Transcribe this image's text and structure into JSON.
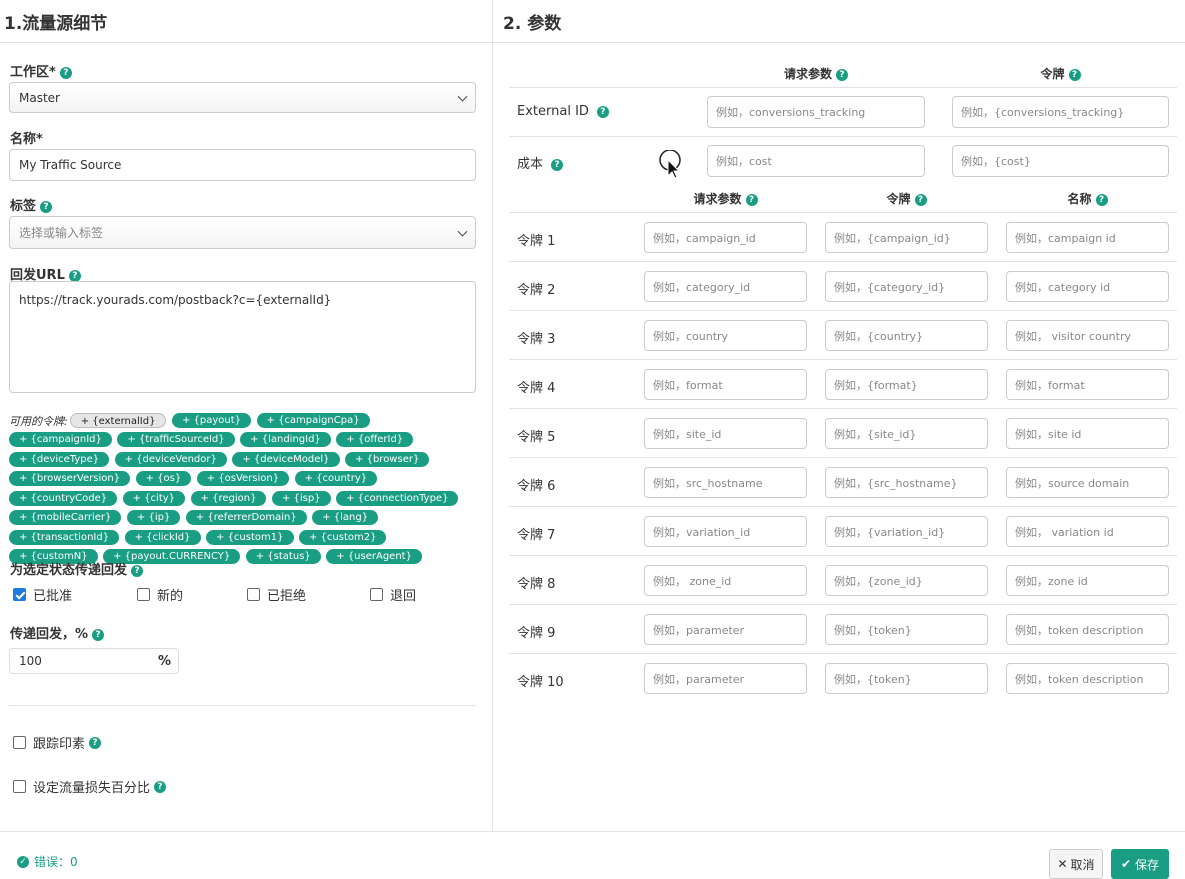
{
  "left": {
    "title": "1.流量源细节",
    "workspace": {
      "label": "工作区*",
      "value": "Master"
    },
    "name": {
      "label": "名称*",
      "value": "My Traffic Source"
    },
    "tags": {
      "label": "标签",
      "placeholder": "选择或输入标签"
    },
    "postback": {
      "label": "回发URL",
      "value": "https://track.yourads.com/postback?c={externalId}"
    },
    "tokens_label": "可用的令牌:",
    "tokens": [
      "+ {externalId}",
      "+ {payout}",
      "+ {campaignCpa}",
      "+ {campaignId}",
      "+ {trafficSourceId}",
      "+ {landingId}",
      "+ {offerId}",
      "+ {deviceType}",
      "+ {deviceVendor}",
      "+ {deviceModel}",
      "+ {browser}",
      "+ {browserVersion}",
      "+ {os}",
      "+ {osVersion}",
      "+ {country}",
      "+ {countryCode}",
      "+ {city}",
      "+ {region}",
      "+ {isp}",
      "+ {connectionType}",
      "+ {mobileCarrier}",
      "+ {ip}",
      "+ {referrerDomain}",
      "+ {lang}",
      "+ {transactionId}",
      "+ {clickId}",
      "+ {custom1}",
      "+ {custom2}",
      "+ {customN}",
      "+ {payout.CURRENCY}",
      "+ {status}",
      "+ {userAgent}"
    ],
    "status_label": "为选定状态传递回发",
    "status_options": [
      {
        "label": "已批准",
        "checked": true
      },
      {
        "label": "新的",
        "checked": false
      },
      {
        "label": "已拒绝",
        "checked": false
      },
      {
        "label": "退回",
        "checked": false
      }
    ],
    "percent_label": "传递回发，%",
    "percent_value": "100",
    "percent_sign": "%",
    "pixel_label": "跟踪印素",
    "loss_label": "设定流量损失百分比"
  },
  "right": {
    "title": "2. 参数",
    "top_headers": {
      "param": "请求参数",
      "token": "令牌"
    },
    "top_rows": [
      {
        "label": "External ID",
        "param_ph": "例如，conversions_tracking",
        "token_ph": "例如，{conversions_tracking}"
      },
      {
        "label": "成本",
        "param_ph": "例如，cost",
        "token_ph": "例如，{cost}"
      }
    ],
    "headers": {
      "param": "请求参数",
      "token": "令牌",
      "name": "名称"
    },
    "rows": [
      {
        "label": "令牌 1",
        "param_ph": "例如，campaign_id",
        "token_ph": "例如，{campaign_id}",
        "name_ph": "例如，campaign id"
      },
      {
        "label": "令牌 2",
        "param_ph": "例如，category_id",
        "token_ph": "例如，{category_id}",
        "name_ph": "例如，category id"
      },
      {
        "label": "令牌 3",
        "param_ph": "例如，country",
        "token_ph": "例如，{country}",
        "name_ph": "例如， visitor country"
      },
      {
        "label": "令牌 4",
        "param_ph": "例如，format",
        "token_ph": "例如，{format}",
        "name_ph": "例如，format"
      },
      {
        "label": "令牌 5",
        "param_ph": "例如，site_id",
        "token_ph": "例如，{site_id}",
        "name_ph": "例如，site id"
      },
      {
        "label": "令牌 6",
        "param_ph": "例如，src_hostname",
        "token_ph": "例如，{src_hostname}",
        "name_ph": "例如，source domain"
      },
      {
        "label": "令牌 7",
        "param_ph": "例如，variation_id",
        "token_ph": "例如，{variation_id}",
        "name_ph": "例如， variation id"
      },
      {
        "label": "令牌 8",
        "param_ph": "例如， zone_id",
        "token_ph": "例如，{zone_id}",
        "name_ph": "例如，zone id"
      },
      {
        "label": "令牌 9",
        "param_ph": "例如，parameter",
        "token_ph": "例如，{token}",
        "name_ph": "例如，token description"
      },
      {
        "label": "令牌 10",
        "param_ph": "例如，parameter",
        "token_ph": "例如，{token}",
        "name_ph": "例如，token description"
      }
    ]
  },
  "footer": {
    "errors": "错误：0",
    "cancel": "取消",
    "save": "保存"
  },
  "colors": {
    "accent": "#1a9e83",
    "checkbox": "#1e7be0"
  }
}
